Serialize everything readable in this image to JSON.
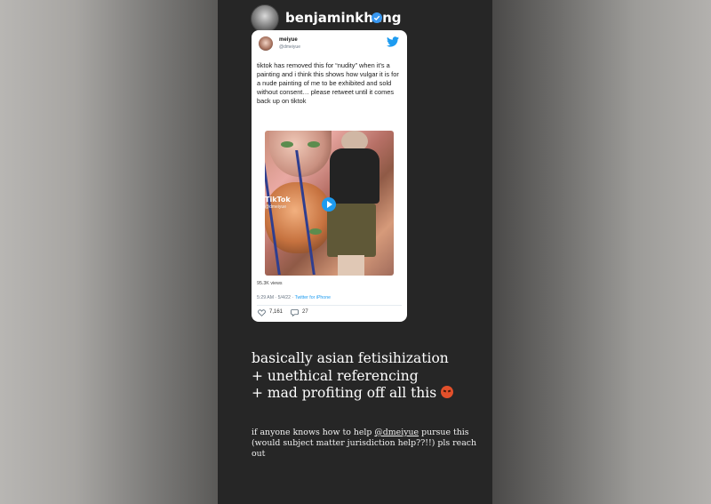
{
  "story": {
    "username": "benjaminkheng",
    "verified": true
  },
  "tweet": {
    "author_name": "meiyue",
    "author_handle": "@dmeiyue",
    "text": "tiktok has removed this for “nudity” when it’s a painting and i think this shows how vulgar it is for a nude painting of me to be exhibited and sold without consent… please retweet until it comes back up on tiktok",
    "media_watermark": "TikTok",
    "media_watermark_handle": "@dmeiyue",
    "views": "95.3K views",
    "timestamp": "5:29 AM · 5/4/22 · ",
    "source": "Twitter for iPhone",
    "likes": "7,161",
    "replies": "27"
  },
  "caption": {
    "line1": "basically asian fetisihization",
    "line2": "+ unethical referencing",
    "line3": "+ mad profiting off all this"
  },
  "help": {
    "prefix": "if anyone knows how to help ",
    "mention": "@dmeiyue",
    "suffix": " pursue this (would subject matter jurisdiction help??!!) pls reach out"
  },
  "colors": {
    "story_bg": "#262626",
    "twitter_blue": "#1d9bf0",
    "angry_emoji": "#e2502b"
  }
}
